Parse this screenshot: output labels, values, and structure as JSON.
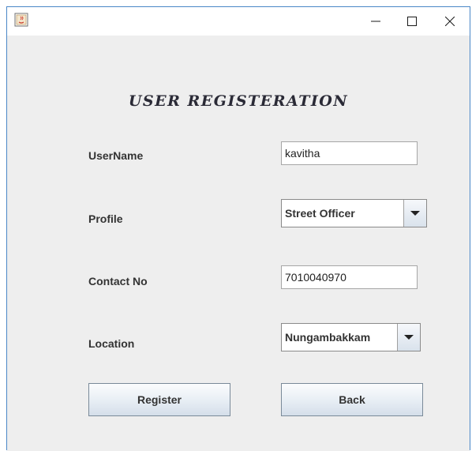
{
  "window": {
    "icon": "java-app-icon",
    "controls": {
      "minimize": "minimize-icon",
      "maximize": "maximize-icon",
      "close": "close-icon"
    },
    "border_color": "#4a87c7"
  },
  "form": {
    "title": "USER REGISTERATION",
    "username": {
      "label": "UserName",
      "value": "kavitha"
    },
    "profile": {
      "label": "Profile",
      "selected": "Street Officer"
    },
    "contact": {
      "label": "Contact No",
      "value": "7010040970"
    },
    "location": {
      "label": "Location",
      "selected": "Nungambakkam"
    },
    "register_label": "Register",
    "back_label": "Back"
  }
}
